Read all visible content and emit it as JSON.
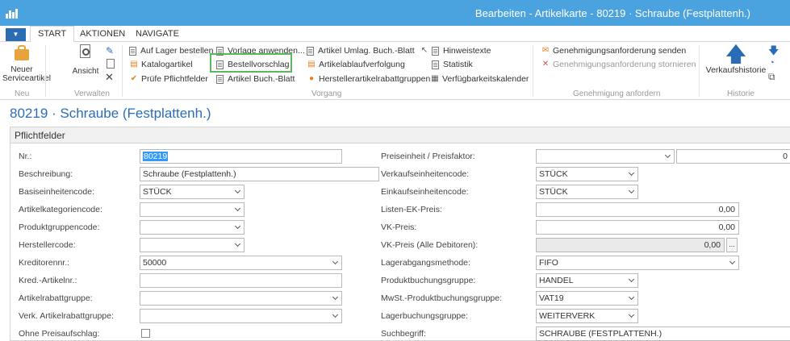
{
  "window": {
    "title": "Bearbeiten - Artikelkarte - 80219 · Schraube (Festplattenh.)"
  },
  "tabs": {
    "start": "START",
    "aktionen": "AKTIONEN",
    "navigate": "NAVIGATE"
  },
  "ribbon": {
    "neu": {
      "new_service_item": "Neuer\nServiceartikel",
      "group": "Neu"
    },
    "verwalten": {
      "view": "Ansicht",
      "group": "Verwalten"
    },
    "vorgang": {
      "group": "Vorgang",
      "items": {
        "auf_lager": "Auf Lager bestellen",
        "vorlage": "Vorlage anwenden...",
        "umlag": "Artikel Umlag. Buch.-Blatt",
        "hinweis": "Hinweistexte",
        "katalog": "Katalogartikel",
        "bestell": "Bestellvorschlag",
        "ablauf": "Artikelablaufverfolgung",
        "statistik": "Statistik",
        "pruefe": "Prüfe Pflichtfelder",
        "buchblatt": "Artikel Buch.-Blatt",
        "hersteller": "Herstellerartikelrabattgruppen",
        "verfuegbar": "Verfügbarkeitskalender"
      }
    },
    "genehmigung": {
      "group": "Genehmigung anfordern",
      "send": "Genehmigungsanforderung senden",
      "cancel": "Genehmigungsanforderung stornieren"
    },
    "historie": {
      "group": "Historie",
      "sales_history": "Verkaufshistorie"
    }
  },
  "page": {
    "heading": "80219 · Schraube (Festplattenh.)"
  },
  "fasttab": {
    "title": "Pflichtfelder"
  },
  "fields": {
    "nr": {
      "label": "Nr.:",
      "value": "80219"
    },
    "beschreibung": {
      "label": "Beschreibung:",
      "value": "Schraube (Festplattenh.)"
    },
    "basiseinheit": {
      "label": "Basiseinheitencode:",
      "value": "STÜCK"
    },
    "kategorie": {
      "label": "Artikelkategoriencode:",
      "value": ""
    },
    "produktgruppe": {
      "label": "Produktgruppencode:",
      "value": ""
    },
    "hersteller": {
      "label": "Herstellercode:",
      "value": ""
    },
    "kreditor": {
      "label": "Kreditorennr.:",
      "value": "50000"
    },
    "kred_artikel": {
      "label": "Kred.-Artikelnr.:",
      "value": ""
    },
    "rabattgruppe": {
      "label": "Artikelrabattgruppe:",
      "value": ""
    },
    "verk_rabattgruppe": {
      "label": "Verk. Artikelrabattgruppe:",
      "value": ""
    },
    "ohne_preis": {
      "label": "Ohne Preisaufschlag:",
      "value": ""
    },
    "preiseinheit": {
      "label": "Preiseinheit / Preisfaktor:",
      "value": "",
      "value2": "0"
    },
    "verkaufseinheit": {
      "label": "Verkaufseinheitencode:",
      "value": "STÜCK"
    },
    "einkaufseinheit": {
      "label": "Einkaufseinheitencode:",
      "value": "STÜCK"
    },
    "listen_ek": {
      "label": "Listen-EK-Preis:",
      "value": "0,00"
    },
    "vk_preis": {
      "label": "VK-Preis:",
      "value": "0,00"
    },
    "vk_alle": {
      "label": "VK-Preis (Alle Debitoren):",
      "value": "0,00",
      "assist": "..."
    },
    "lagerabgang": {
      "label": "Lagerabgangsmethode:",
      "value": "FIFO"
    },
    "produktbuchung": {
      "label": "Produktbuchungsgruppe:",
      "value": "HANDEL"
    },
    "mwst": {
      "label": "MwSt.-Produktbuchungsgruppe:",
      "value": "VAT19"
    },
    "lagerbuchung": {
      "label": "Lagerbuchungsgruppe:",
      "value": "WEITERVERK"
    },
    "suchbegriff": {
      "label": "Suchbegriff:",
      "value": "SCHRAUBE (FESTPLATTENH.)"
    }
  }
}
